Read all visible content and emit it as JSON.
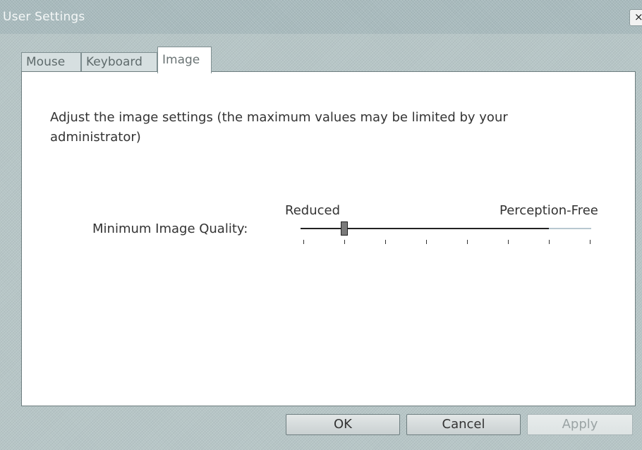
{
  "window": {
    "title": "User Settings",
    "close_label": "×"
  },
  "tabs": [
    {
      "label": "Mouse",
      "active": false
    },
    {
      "label": "Keyboard",
      "active": false
    },
    {
      "label": "Image",
      "active": true
    }
  ],
  "image_panel": {
    "description": "Adjust the image settings (the maximum values may be limited by your administrator)",
    "quality": {
      "label": "Minimum Image Quality:",
      "min_label": "Reduced",
      "max_label": "Perception-Free",
      "tick_count": 8,
      "selected_step": 2,
      "max_allowed_step": 7
    }
  },
  "buttons": {
    "ok": "OK",
    "cancel": "Cancel",
    "apply": "Apply"
  },
  "colors": {
    "track_filled": "#222222",
    "track_disabled": "#b8c8d0",
    "thumb": "#7a7a7a"
  }
}
